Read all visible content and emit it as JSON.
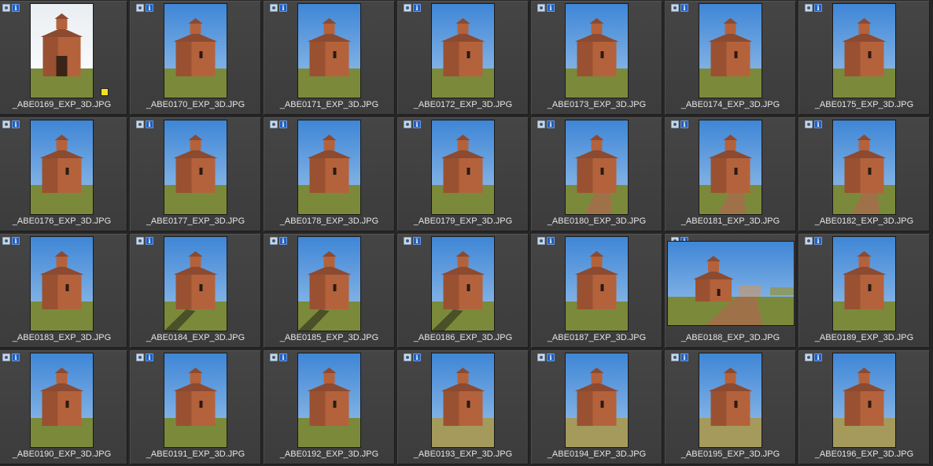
{
  "window": {
    "title": ""
  },
  "colors": {
    "sky": "#3f86d6",
    "sky_pale": "#e9eef2",
    "stone": "#b4623c",
    "stone_dark": "#7e3f26",
    "roof": "#8c4a30",
    "grass": "#7a8a3a",
    "grass_dry": "#a49a5c",
    "path": "#a66c4c",
    "flag_yellow": "#f2e21a"
  },
  "icons": {
    "camera": "camera-icon",
    "info": "info-icon",
    "flag": "color-label-icon"
  },
  "badges": {
    "info_glyph": "i"
  },
  "thumbnails": [
    {
      "filename": "_ABE0169_EXP_3D.JPG",
      "orientation": "portrait",
      "variant": "door",
      "label": "yellow"
    },
    {
      "filename": "_ABE0170_EXP_3D.JPG",
      "orientation": "portrait",
      "variant": "side"
    },
    {
      "filename": "_ABE0171_EXP_3D.JPG",
      "orientation": "portrait",
      "variant": "side"
    },
    {
      "filename": "_ABE0172_EXP_3D.JPG",
      "orientation": "portrait",
      "variant": "side"
    },
    {
      "filename": "_ABE0173_EXP_3D.JPG",
      "orientation": "portrait",
      "variant": "side"
    },
    {
      "filename": "_ABE0174_EXP_3D.JPG",
      "orientation": "portrait",
      "variant": "side"
    },
    {
      "filename": "_ABE0175_EXP_3D.JPG",
      "orientation": "portrait",
      "variant": "side"
    },
    {
      "filename": "_ABE0176_EXP_3D.JPG",
      "orientation": "portrait",
      "variant": "corner"
    },
    {
      "filename": "_ABE0177_EXP_3D.JPG",
      "orientation": "portrait",
      "variant": "corner"
    },
    {
      "filename": "_ABE0178_EXP_3D.JPG",
      "orientation": "portrait",
      "variant": "corner"
    },
    {
      "filename": "_ABE0179_EXP_3D.JPG",
      "orientation": "portrait",
      "variant": "corner"
    },
    {
      "filename": "_ABE0180_EXP_3D.JPG",
      "orientation": "portrait",
      "variant": "path"
    },
    {
      "filename": "_ABE0181_EXP_3D.JPG",
      "orientation": "portrait",
      "variant": "path"
    },
    {
      "filename": "_ABE0182_EXP_3D.JPG",
      "orientation": "portrait",
      "variant": "path"
    },
    {
      "filename": "_ABE0183_EXP_3D.JPG",
      "orientation": "portrait",
      "variant": "corner"
    },
    {
      "filename": "_ABE0184_EXP_3D.JPG",
      "orientation": "portrait",
      "variant": "shadow"
    },
    {
      "filename": "_ABE0185_EXP_3D.JPG",
      "orientation": "portrait",
      "variant": "shadow"
    },
    {
      "filename": "_ABE0186_EXP_3D.JPG",
      "orientation": "portrait",
      "variant": "shadow"
    },
    {
      "filename": "_ABE0187_EXP_3D.JPG",
      "orientation": "portrait",
      "variant": "corner"
    },
    {
      "filename": "_ABE0188_EXP_3D.JPG",
      "orientation": "landscape",
      "variant": "wide"
    },
    {
      "filename": "_ABE0189_EXP_3D.JPG",
      "orientation": "portrait",
      "variant": "corner"
    },
    {
      "filename": "_ABE0190_EXP_3D.JPG",
      "orientation": "portrait",
      "variant": "front"
    },
    {
      "filename": "_ABE0191_EXP_3D.JPG",
      "orientation": "portrait",
      "variant": "front"
    },
    {
      "filename": "_ABE0192_EXP_3D.JPG",
      "orientation": "portrait",
      "variant": "front"
    },
    {
      "filename": "_ABE0193_EXP_3D.JPG",
      "orientation": "portrait",
      "variant": "dry"
    },
    {
      "filename": "_ABE0194_EXP_3D.JPG",
      "orientation": "portrait",
      "variant": "dry"
    },
    {
      "filename": "_ABE0195_EXP_3D.JPG",
      "orientation": "portrait",
      "variant": "dry"
    },
    {
      "filename": "_ABE0196_EXP_3D.JPG",
      "orientation": "portrait",
      "variant": "dry"
    }
  ]
}
